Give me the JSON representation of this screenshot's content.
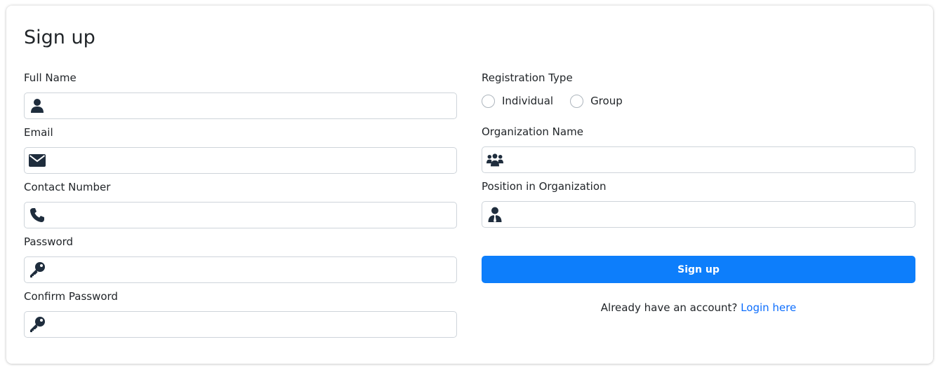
{
  "form": {
    "title": "Sign up",
    "fields_left": [
      {
        "label": "Full Name",
        "icon": "user-icon",
        "value": ""
      },
      {
        "label": "Email",
        "icon": "envelope-icon",
        "value": ""
      },
      {
        "label": "Contact Number",
        "icon": "phone-icon",
        "value": ""
      },
      {
        "label": "Password",
        "icon": "key-icon",
        "value": ""
      },
      {
        "label": "Confirm Password",
        "icon": "key-icon",
        "value": ""
      }
    ],
    "registration_type": {
      "label": "Registration Type",
      "options": [
        "Individual",
        "Group"
      ]
    },
    "fields_right": [
      {
        "label": "Organization Name",
        "icon": "users-icon",
        "value": ""
      },
      {
        "label": "Position in Organization",
        "icon": "user-tie-icon",
        "value": ""
      }
    ],
    "submit_label": "Sign up",
    "login_prompt": "Already have an account?",
    "login_link": "Login here"
  },
  "colors": {
    "primary": "#0d7efb",
    "link": "#0d6efd",
    "icon": "#1f2d3d",
    "border": "#ced4da"
  }
}
